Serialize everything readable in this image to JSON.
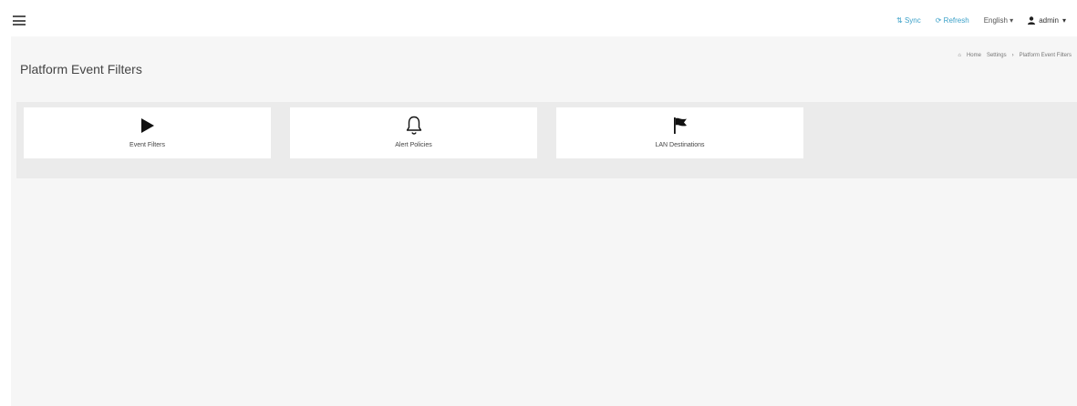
{
  "topnav": {
    "sync_label": "Sync",
    "refresh_label": "Refresh",
    "language_label": "English",
    "user_label": "admin"
  },
  "page": {
    "title": "Platform Event Filters"
  },
  "breadcrumb": {
    "home": "Home",
    "settings": "Settings",
    "current": "Platform Event Filters"
  },
  "tiles": [
    {
      "label": "Event Filters",
      "icon": "play-icon"
    },
    {
      "label": "Alert Policies",
      "icon": "bell-icon"
    },
    {
      "label": "LAN Destinations",
      "icon": "flag-icon"
    }
  ]
}
